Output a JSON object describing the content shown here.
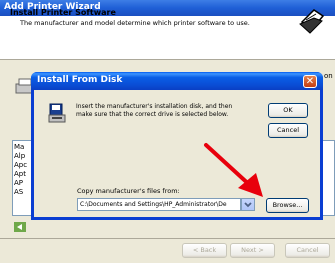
{
  "wizard": {
    "title": "Add Printer Wizard",
    "header_title": "Install Printer Software",
    "header_subtitle": "The manufacturer and model determine which printer software to use.",
    "partial_right_text": "on",
    "back_list_items": [
      "Ma",
      "Alp",
      "Apc",
      "Apt",
      "AP",
      "AS"
    ],
    "back_button": "< Back",
    "next_button": "Next >",
    "cancel_button": "Cancel"
  },
  "dialog": {
    "title": "Install From Disk",
    "message": "Insert the manufacturer's installation disk, and then make sure that the correct drive is selected below.",
    "ok_button": "OK",
    "cancel_button": "Cancel",
    "copy_label": "Copy manufacturer's files from:",
    "path_value": "C:\\Documents and Settings\\HP_Administrator\\De",
    "browse_button": "Browse..."
  },
  "annotation": {
    "arrow_color": "#e8000c"
  }
}
